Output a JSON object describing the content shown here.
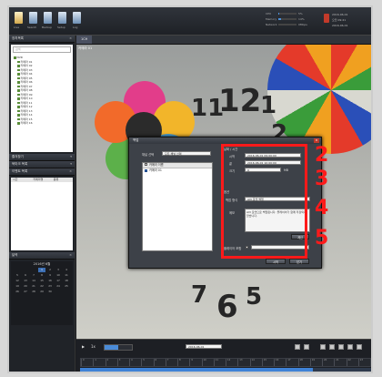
{
  "toolbar": {
    "buttons": [
      "Live",
      "Search",
      "Backup",
      "Setup",
      "Log"
    ],
    "system": [
      {
        "label": "CPU",
        "value": "5%",
        "fill": 0.05
      },
      {
        "label": "Memory",
        "value": "14%",
        "fill": 0.14
      },
      {
        "label": "Network",
        "value": "0Mbps",
        "fill": 0.0
      }
    ],
    "user": {
      "date": "2016-06-01",
      "time": "오전 09:41",
      "line3": "2016-06-01"
    }
  },
  "sidebar": {
    "camera_panel_title": "장치목록",
    "search_placeholder": "검색",
    "tree": [
      "NVR",
      "카메라 01",
      "카메라 02",
      "카메라 03",
      "카메라 04",
      "카메라 05",
      "카메라 06",
      "카메라 07",
      "카메라 08",
      "카메라 09",
      "카메라 10",
      "카메라 11",
      "카메라 12",
      "카메라 13",
      "카메라 14",
      "카메라 15",
      "카메라 16"
    ],
    "panel2_title": "즐겨찾기",
    "panel3_title": "북마크 목록",
    "panel4_title": "이벤트 목록",
    "grid_cols": [
      "시간",
      "카메라명",
      "종류"
    ],
    "calendar_title": "달력",
    "calendar_month": "2016년 6월",
    "calendar_days": [
      "",
      "",
      "",
      "1",
      "2",
      "3",
      "4",
      "5",
      "6",
      "7",
      "8",
      "9",
      "10",
      "11",
      "12",
      "13",
      "14",
      "15",
      "16",
      "17",
      "18",
      "19",
      "20",
      "21",
      "22",
      "23",
      "24",
      "25",
      "26",
      "27",
      "28",
      "29",
      "30",
      "",
      "",
      ""
    ]
  },
  "main": {
    "tab": "1CH",
    "camera_label": "카메라 01",
    "clock_numbers": [
      "11",
      "12",
      "1",
      "2",
      "7",
      "6",
      "5"
    ]
  },
  "dialog": {
    "title": "백업",
    "left_label": "채널 선택",
    "left_select": "모든 채널 선택",
    "list_header": "카메라 이름",
    "list_items": [
      "카메라 01"
    ],
    "group_time": "날짜 / 시간",
    "start_label": "시작",
    "start_value": "2016-06-01 09:00:00",
    "end_label": "끝",
    "end_value": "2016-06-01 10:00:00",
    "size_label": "크기",
    "size_value": "0",
    "size_unit": "MB",
    "options_label": "옵션",
    "format_label": "백업 형식",
    "format_value": "AVI 포맷 백업",
    "memo_label": "메모",
    "memo_text": "AVI 포맷으로 백업됩니다. 플레이어가 함께 저장되지 않습니다.",
    "calc_button": "계산",
    "player_label": "플레이어 포함",
    "ok_button": "시작",
    "cancel_button": "닫기"
  },
  "annotations": [
    "2",
    "3",
    "4",
    "5"
  ],
  "timeline": {
    "play_label": "▶",
    "speed_label": "1x",
    "speed_fill": 0.5,
    "date_value": "2016-06-01",
    "hours": [
      "0",
      "1",
      "2",
      "3",
      "4",
      "5",
      "6",
      "7",
      "8",
      "9",
      "10",
      "11",
      "12",
      "13",
      "14",
      "15",
      "16",
      "17",
      "18",
      "19",
      "20",
      "21",
      "22",
      "23"
    ],
    "progress": 0.8
  },
  "colors": {
    "highlight": "#ff1a1a",
    "accent": "#3f82d6"
  }
}
